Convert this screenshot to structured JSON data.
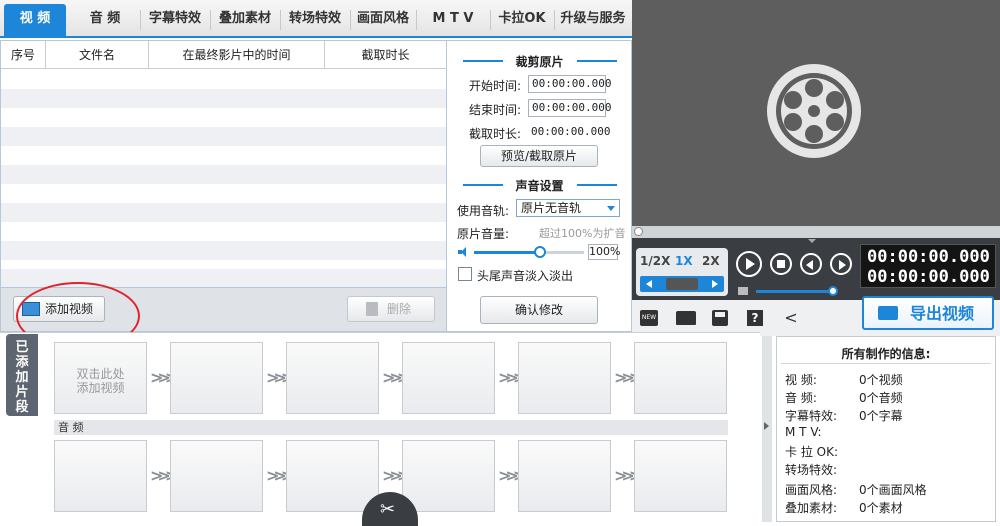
{
  "tabs": [
    "视 频",
    "音 频",
    "字幕特效",
    "叠加素材",
    "转场特效",
    "画面风格",
    "M T V",
    "卡拉OK",
    "升级与服务"
  ],
  "table": {
    "columns": [
      "序号",
      "文件名",
      "在最终影片中的时间",
      "截取时长"
    ]
  },
  "table_bar": {
    "add_video": "添加视频",
    "delete": "删除"
  },
  "clip": {
    "title": "裁剪原片",
    "start_label": "开始时间:",
    "start_value": "00:00:00.000",
    "end_label": "结束时间:",
    "end_value": "00:00:00.000",
    "duration_label": "截取时长:",
    "duration_value": "00:00:00.000",
    "preview_button": "预览/截取原片"
  },
  "audio": {
    "title": "声音设置",
    "track_label": "使用音轨:",
    "track_value": "原片无音轨",
    "volume_label": "原片音量:",
    "volume_hint": "超过100%为扩音",
    "volume_value": "100%",
    "volume_level": 0.6,
    "fade_label": "头尾声音淡入淡出",
    "confirm_button": "确认修改"
  },
  "player": {
    "speeds": [
      "1/2X",
      "1X",
      "2X"
    ],
    "time_current": "00:00:00.000",
    "time_total": "00:00:00.000",
    "export_button": "导出视频",
    "new_icon_text": "NEW"
  },
  "clips": {
    "side_tab": "已添加片段",
    "first_slot_text_1": "双击此处",
    "first_slot_text_2": "添加视频",
    "audio_label": "音 频"
  },
  "info": {
    "title": "所有制作的信息:",
    "rows": [
      {
        "label": "视    频:",
        "value": "0个视频"
      },
      {
        "label": "音    频:",
        "value": "0个音频"
      },
      {
        "label": "字幕特效:",
        "value": "0个字幕"
      },
      {
        "label": "M  T  V:",
        "value": ""
      },
      {
        "label": "卡 拉 OK:",
        "value": ""
      },
      {
        "label": "转场特效:",
        "value": ""
      },
      {
        "label": "画面风格:",
        "value": "0个画面风格"
      },
      {
        "label": "叠加素材:",
        "value": "0个素材"
      }
    ]
  },
  "colors": {
    "accent": "#1e86d8",
    "highlight_circle": "#e0242c"
  }
}
